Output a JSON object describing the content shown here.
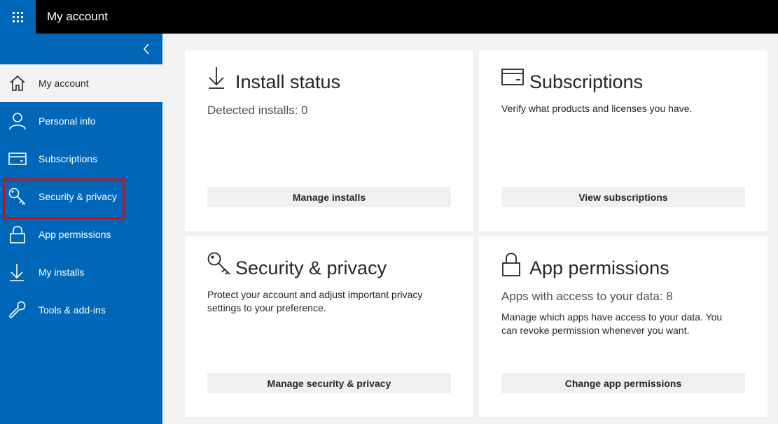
{
  "header": {
    "title": "My account"
  },
  "sidebar": {
    "items": [
      {
        "label": "My account",
        "icon": "home-icon"
      },
      {
        "label": "Personal info",
        "icon": "person-icon"
      },
      {
        "label": "Subscriptions",
        "icon": "card-icon"
      },
      {
        "label": "Security & privacy",
        "icon": "key-icon"
      },
      {
        "label": "App permissions",
        "icon": "lock-icon"
      },
      {
        "label": "My installs",
        "icon": "download-icon"
      },
      {
        "label": "Tools & add-ins",
        "icon": "wrench-icon"
      }
    ]
  },
  "cards": {
    "install": {
      "title": "Install status",
      "subtitle": "Detected installs: 0",
      "button": "Manage installs"
    },
    "subscriptions": {
      "title": "Subscriptions",
      "text": "Verify what products and licenses you have.",
      "button": "View subscriptions"
    },
    "security": {
      "title": "Security & privacy",
      "text": "Protect your account and adjust important privacy settings to your preference.",
      "button": "Manage security & privacy"
    },
    "permissions": {
      "title": "App permissions",
      "subtitle": "Apps with access to your data: 8",
      "text": "Manage which apps have access to your data. You can revoke permission whenever you want.",
      "button": "Change app permissions"
    }
  },
  "colors": {
    "accent": "#0067b8",
    "topbar": "#000000",
    "highlight": "#c4141c",
    "background": "#f2f2f2"
  }
}
